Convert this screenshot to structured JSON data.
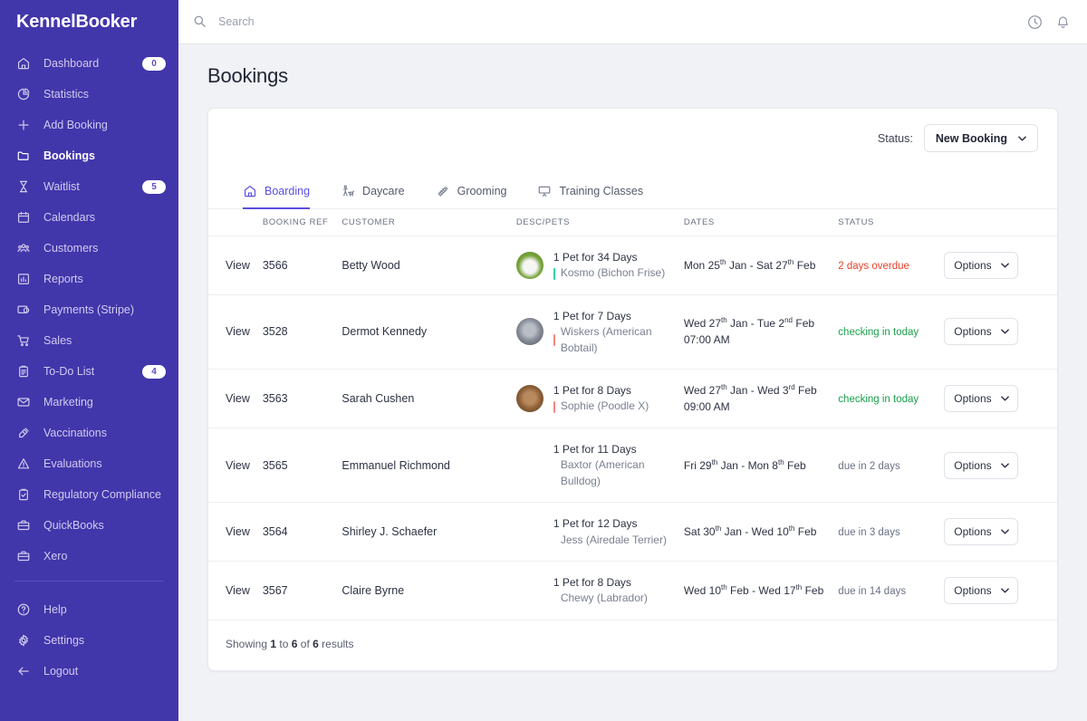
{
  "brand": {
    "name": "KennelBooker"
  },
  "search": {
    "placeholder": "Search",
    "value": ""
  },
  "topbar": {
    "clock_icon": "clock-icon",
    "bell_icon": "bell-icon"
  },
  "sidebar": {
    "items": [
      {
        "label": "Dashboard",
        "icon": "home-icon",
        "badge": "0",
        "active": false
      },
      {
        "label": "Statistics",
        "icon": "pie-chart-icon",
        "badge": "",
        "active": false
      },
      {
        "label": "Add Booking",
        "icon": "plus-icon",
        "badge": "",
        "active": false
      },
      {
        "label": "Bookings",
        "icon": "folder-icon",
        "badge": "",
        "active": true
      },
      {
        "label": "Waitlist",
        "icon": "hourglass-icon",
        "badge": "5",
        "active": false
      },
      {
        "label": "Calendars",
        "icon": "calendar-icon",
        "badge": "",
        "active": false
      },
      {
        "label": "Customers",
        "icon": "people-icon",
        "badge": "",
        "active": false
      },
      {
        "label": "Reports",
        "icon": "bar-chart-icon",
        "badge": "",
        "active": false
      },
      {
        "label": "Payments (Stripe)",
        "icon": "card-payment-icon",
        "badge": "",
        "active": false
      },
      {
        "label": "Sales",
        "icon": "shopping-cart-icon",
        "badge": "",
        "active": false
      },
      {
        "label": "To-Do List",
        "icon": "clipboard-list-icon",
        "badge": "4",
        "active": false
      },
      {
        "label": "Marketing",
        "icon": "envelope-icon",
        "badge": "",
        "active": false
      },
      {
        "label": "Vaccinations",
        "icon": "syringe-icon",
        "badge": "",
        "active": false
      },
      {
        "label": "Evaluations",
        "icon": "warning-triangle-icon",
        "badge": "",
        "active": false
      },
      {
        "label": "Regulatory Compliance",
        "icon": "clipboard-check-icon",
        "badge": "",
        "active": false
      },
      {
        "label": "QuickBooks",
        "icon": "briefcase-icon",
        "badge": "",
        "active": false
      },
      {
        "label": "Xero",
        "icon": "briefcase-icon",
        "badge": "",
        "active": false
      }
    ],
    "footer_items": [
      {
        "label": "Help",
        "icon": "question-circle-icon"
      },
      {
        "label": "Settings",
        "icon": "gear-icon"
      },
      {
        "label": "Logout",
        "icon": "arrow-left-icon"
      }
    ]
  },
  "page": {
    "title": "Bookings"
  },
  "filters": {
    "status_label": "Status:",
    "status_value": "New Booking",
    "chevron_icon": "chevron-down-icon"
  },
  "tabs": [
    {
      "label": "Boarding",
      "icon": "home-icon",
      "active": true
    },
    {
      "label": "Daycare",
      "icon": "dog-walking-icon",
      "active": false
    },
    {
      "label": "Grooming",
      "icon": "grooming-brush-icon",
      "active": false
    },
    {
      "label": "Training Classes",
      "icon": "whiteboard-icon",
      "active": false
    }
  ],
  "table": {
    "columns": [
      "",
      "BOOKING REF",
      "CUSTOMER",
      "DESC/PETS",
      "DATES",
      "STATUS",
      ""
    ],
    "view_label": "View",
    "options_label": "Options",
    "rows": [
      {
        "view": "View",
        "ref": "3566",
        "customer": "Betty Wood",
        "has_avatar": true,
        "avatar_kind": "white-dog",
        "desc_line1": "1 Pet for 34 Days",
        "pet": "Kosmo (Bichon Frise)",
        "pet_bar_color": "#2fd1a5",
        "date_start_day": "Mon 25",
        "date_start_ord": "th",
        "date_start_month": "Jan",
        "date_end_day": "Sat 27",
        "date_end_ord": "th",
        "date_end_month": "Feb",
        "time": "",
        "status": "2 days overdue",
        "status_kind": "overdue",
        "options": "Options"
      },
      {
        "view": "View",
        "ref": "3528",
        "customer": "Dermot Kennedy",
        "has_avatar": true,
        "avatar_kind": "grey-cat",
        "desc_line1": "1 Pet for 7 Days",
        "pet": "Wiskers (American Bobtail)",
        "pet_bar_color": "#f4857f",
        "date_start_day": "Wed 27",
        "date_start_ord": "th",
        "date_start_month": "Jan",
        "date_end_day": "Tue 2",
        "date_end_ord": "nd",
        "date_end_month": "Feb",
        "time": "07:00 AM",
        "status": "checking in today",
        "status_kind": "checkin",
        "options": "Options"
      },
      {
        "view": "View",
        "ref": "3563",
        "customer": "Sarah Cushen",
        "has_avatar": true,
        "avatar_kind": "brown-dog",
        "desc_line1": "1 Pet for 8 Days",
        "pet": "Sophie (Poodle X)",
        "pet_bar_color": "#f4857f",
        "date_start_day": "Wed 27",
        "date_start_ord": "th",
        "date_start_month": "Jan",
        "date_end_day": "Wed 3",
        "date_end_ord": "rd",
        "date_end_month": "Feb",
        "time": "09:00 AM",
        "status": "checking in today",
        "status_kind": "checkin",
        "options": "Options"
      },
      {
        "view": "View",
        "ref": "3565",
        "customer": "Emmanuel Richmond",
        "has_avatar": false,
        "avatar_kind": "",
        "desc_line1": "1 Pet for 11 Days",
        "pet": "Baxtor (American Bulldog)",
        "pet_bar_color": "",
        "date_start_day": "Fri 29",
        "date_start_ord": "th",
        "date_start_month": "Jan",
        "date_end_day": "Mon 8",
        "date_end_ord": "th",
        "date_end_month": "Feb",
        "time": "",
        "status": "due in 2 days",
        "status_kind": "due",
        "options": "Options"
      },
      {
        "view": "View",
        "ref": "3564",
        "customer": "Shirley J. Schaefer",
        "has_avatar": false,
        "avatar_kind": "",
        "desc_line1": "1 Pet for 12 Days",
        "pet": "Jess (Airedale Terrier)",
        "pet_bar_color": "",
        "date_start_day": "Sat 30",
        "date_start_ord": "th",
        "date_start_month": "Jan",
        "date_end_day": "Wed 10",
        "date_end_ord": "th",
        "date_end_month": "Feb",
        "time": "",
        "status": "due in 3 days",
        "status_kind": "due",
        "options": "Options"
      },
      {
        "view": "View",
        "ref": "3567",
        "customer": "Claire Byrne",
        "has_avatar": false,
        "avatar_kind": "",
        "desc_line1": "1 Pet for 8 Days",
        "pet": "Chewy (Labrador)",
        "pet_bar_color": "",
        "date_start_day": "Wed 10",
        "date_start_ord": "th",
        "date_start_month": "Feb",
        "date_end_day": "Wed 17",
        "date_end_ord": "th",
        "date_end_month": "Feb",
        "time": "",
        "status": "due in 14 days",
        "status_kind": "due",
        "options": "Options"
      }
    ]
  },
  "footer": {
    "prefix": "Showing ",
    "from": "1",
    "mid": " to ",
    "to": "6",
    "mid2": " of ",
    "total": "6",
    "suffix": " results"
  },
  "colors": {
    "sidebar_bg": "#4236ab",
    "accent": "#5a4fe0",
    "overdue": "#e8402a",
    "checkin": "#1a9e4b",
    "muted": "#6a7183"
  }
}
